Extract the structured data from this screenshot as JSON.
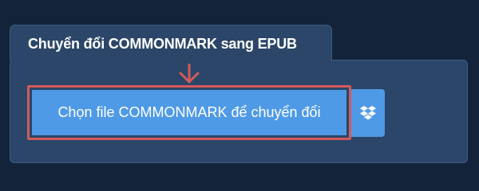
{
  "tab": {
    "title": "Chuyển đổi COMMONMARK sang EPUB"
  },
  "upload": {
    "choose_label": "Chọn file COMMONMARK để chuyển đổi",
    "arrow_icon": "arrow-down-icon",
    "dropbox_icon": "dropbox-icon"
  },
  "colors": {
    "background": "#13233a",
    "panel": "#2b4668",
    "button": "#4f9ae6",
    "highlight": "#d35a5a"
  }
}
